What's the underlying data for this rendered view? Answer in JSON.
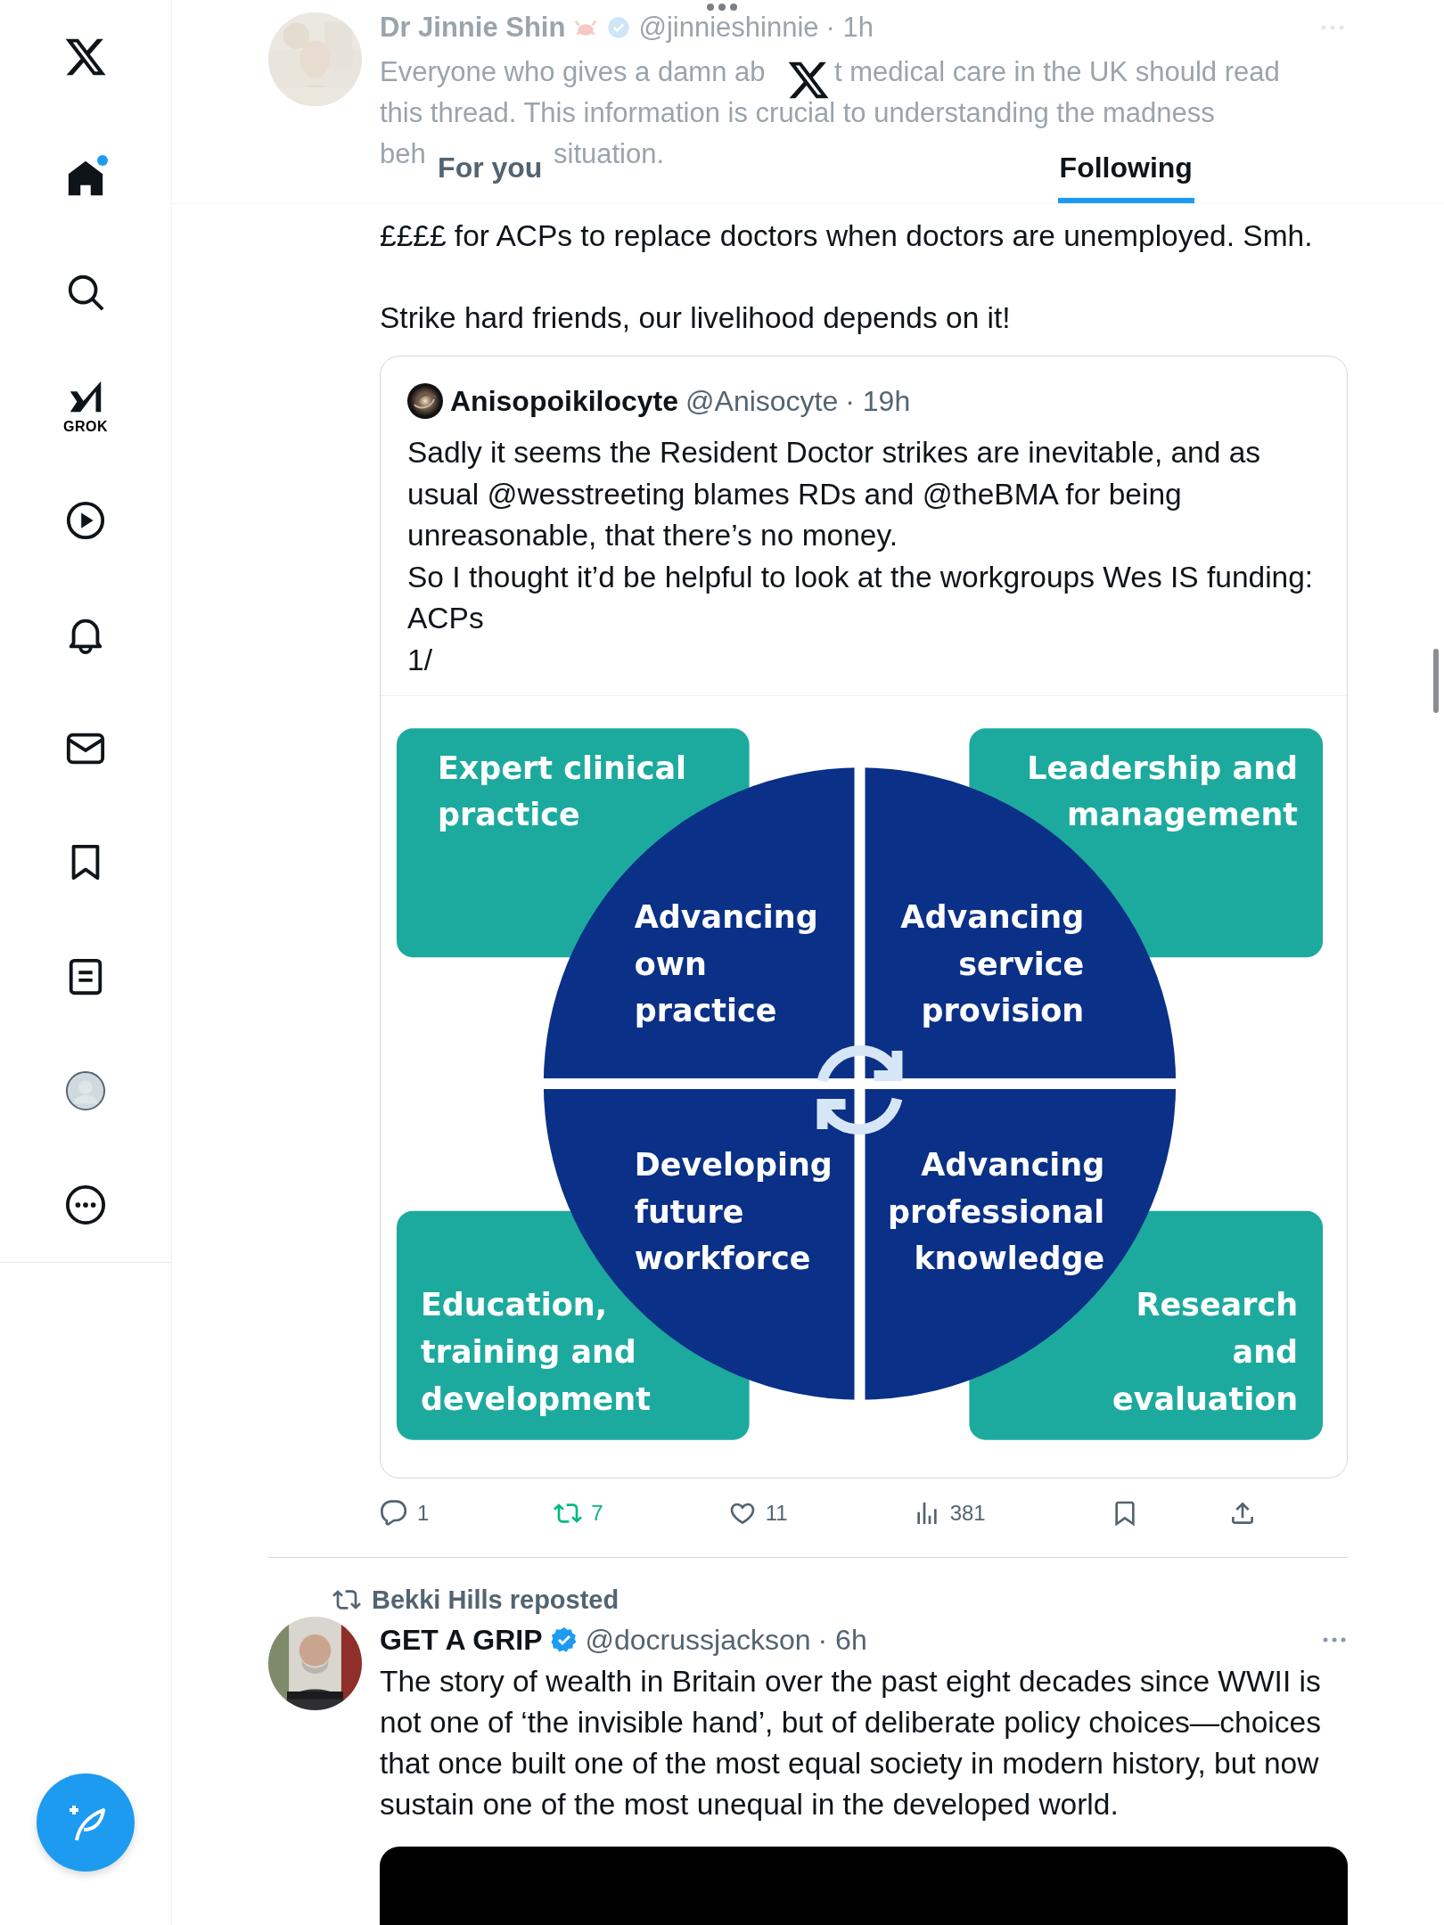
{
  "sidebar": {
    "items": [
      {
        "kind": "home",
        "selected": true,
        "dot": true
      },
      {
        "kind": "search",
        "selected": false,
        "dot": false
      },
      {
        "kind": "grok",
        "label": "GROK",
        "selected": false,
        "dot": false
      },
      {
        "kind": "video",
        "selected": false,
        "dot": false
      },
      {
        "kind": "notifications",
        "selected": false,
        "dot": false
      },
      {
        "kind": "messages",
        "selected": false,
        "dot": false
      },
      {
        "kind": "bookmarks",
        "selected": false,
        "dot": false
      },
      {
        "kind": "lists",
        "selected": false,
        "dot": false
      },
      {
        "kind": "profile",
        "selected": false,
        "dot": false
      },
      {
        "kind": "more",
        "selected": false,
        "dot": false
      }
    ]
  },
  "faded_tweet": {
    "name": "Dr Jinnie Shin",
    "verified": true,
    "handle": "@jinnieshinnie",
    "time": "· 1h",
    "lines": [
      [
        "Everyone who gives a damn ab",
        "t medical care in the UK should read"
      ],
      [
        "this thread. This information is crucial to understanding the madness"
      ],
      [
        "beh",
        "situation."
      ]
    ]
  },
  "tabs": [
    {
      "label": "For you",
      "selected": false
    },
    {
      "label": "Following",
      "selected": true
    }
  ],
  "tweet": {
    "text": "££££ for ACPs to replace doctors when doctors are unemployed. Smh.\n\nStrike hard friends, our livelihood depends on it!",
    "quote": {
      "name": "Anisopoikilocyte",
      "handle": "@Anisocyte",
      "time": "· 19h",
      "text": "Sadly it seems the Resident Doctor strikes are inevitable, and as usual @wesstreeting blames RDs and @theBMA for being unreasonable, that there’s no money.\nSo I thought it’d be helpful to look at the workgroups Wes IS funding: ACPs\n1/",
      "diagram": {
        "labels": [
          {
            "lines": [
              "Expert clinical",
              "practice"
            ]
          },
          {
            "lines": [
              "Leadership and",
              "management"
            ]
          },
          {
            "lines": [
              "Advancing",
              "own",
              "practice"
            ]
          },
          {
            "lines": [
              "Advancing",
              "service",
              "provision"
            ]
          },
          {
            "lines": [
              "Developing",
              "future",
              "workforce"
            ]
          },
          {
            "lines": [
              "Advancing",
              "professional",
              "knowledge"
            ]
          },
          {
            "lines": [
              "Education,",
              "training and",
              "development"
            ]
          },
          {
            "lines": [
              "Research",
              "and",
              "evaluation"
            ]
          }
        ]
      }
    },
    "actions": [
      {
        "kind": "reply",
        "count": "1",
        "active": false
      },
      {
        "kind": "repost",
        "count": "7",
        "active": true
      },
      {
        "kind": "like",
        "count": "11",
        "active": false
      },
      {
        "kind": "views",
        "count": "381",
        "active": false
      },
      {
        "kind": "bookmark",
        "active": false
      },
      {
        "kind": "share",
        "active": false
      }
    ]
  },
  "second_tweet": {
    "repost_line": "Bekki Hills reposted",
    "name": "GET A GRIP",
    "verified": true,
    "handle": "@docrussjackson",
    "time": "· 6h",
    "text": "The story of wealth in Britain over the past eight decades since WWII is not one of ‘the invisible hand’, but of deliberate policy choices—choices that once built one of the most equal society in modern history, but now sustain one of the most unequal in the developed world."
  }
}
